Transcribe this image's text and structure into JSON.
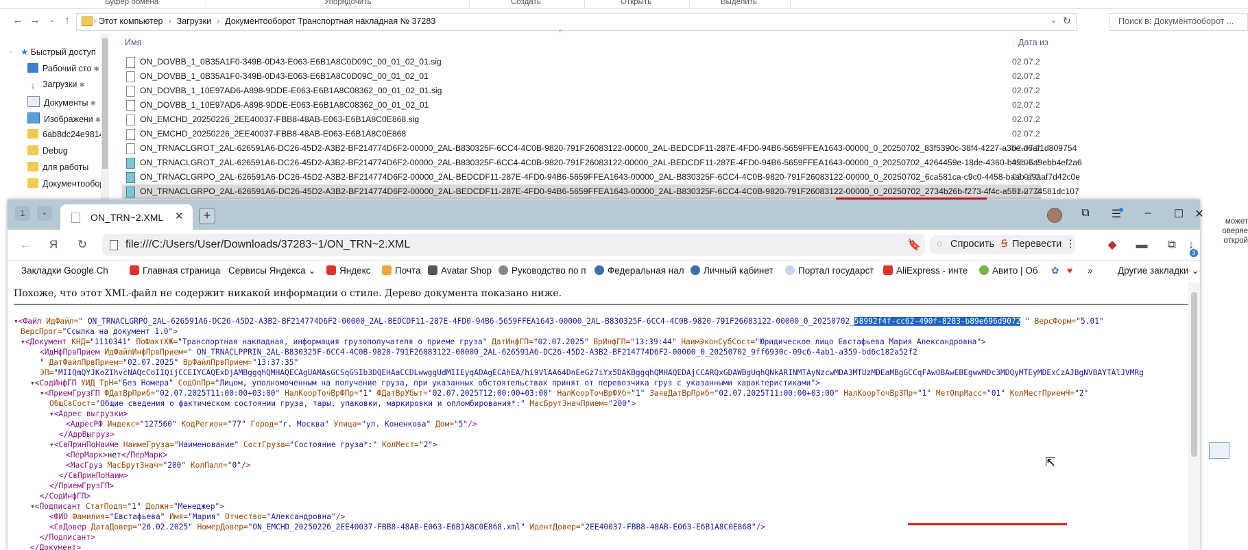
{
  "explorer": {
    "ribbon": [
      "Буфер обмена",
      "Упорядочить",
      "Создать",
      "Открыть",
      "Выделить"
    ],
    "breadcrumbs": [
      "Этот компьютер",
      "Загрузки",
      "Документооборот Транспортная накладная № 37283"
    ],
    "search_placeholder": "Поиск в: Документооборот ...",
    "nav_items": [
      "Быстрый доступ",
      "Рабочий сто",
      "Загрузки",
      "Документы",
      "Изображени",
      "6ab8dc24e9814a",
      "Debug",
      "для работы",
      "Документообор"
    ],
    "columns": {
      "name": "Имя",
      "date": "Дата из"
    },
    "files": [
      {
        "name": "ON_DOVBB_1_0B35A1F0-349B-0D43-E063-E6B1A8C0D09C_00_01_02_01.sig",
        "date": "02.07.20"
      },
      {
        "name": "ON_DOVBB_1_0B35A1F0-349B-0D43-E063-E6B1A8C0D09C_00_01_02_01",
        "date": "02.07.20"
      },
      {
        "name": "ON_DOVBB_1_10E97AD6-A898-9DDE-E063-E6B1A8C08362_00_01_02_01.sig",
        "date": "02.07.20"
      },
      {
        "name": "ON_DOVBB_1_10E97AD6-A898-9DDE-E063-E6B1A8C08362_00_01_02_01",
        "date": "02.07.20"
      },
      {
        "name": "ON_EMCHD_20250226_2EE40037-FBB8-48AB-E063-E6B1A8C0E868.sig",
        "date": "02.07.20"
      },
      {
        "name": "ON_EMCHD_20250226_2EE40037-FBB8-48AB-E063-E6B1A8C0E868",
        "date": "02.07.20"
      },
      {
        "name": "ON_TRNACLGROT_2AL-626591A6-DC26-45D2-A3B2-BF214774D6F2-00000_2AL-B830325F-6CC4-4C0B-9820-791F26083122-00000_2AL-BEDCDF11-287E-4FD0-94B6-5659FFEA1643-00000_0_20250702_83f5390c-38f4-4227-a3be-d6af1d809754",
        "date": "02.07.20"
      },
      {
        "name": "ON_TRNACLGROT_2AL-626591A6-DC26-45D2-A3B2-BF214774D6F2-00000_2AL-B830325F-6CC4-4C0B-9820-791F26083122-00000_2AL-BEDCDF11-287E-4FD0-94B6-5659FFEA1643-00000_0_20250702_4264459e-18de-4360-b45b-6a9ebb4ef2a6",
        "date": "02.07.20"
      },
      {
        "name": "ON_TRNACLGRPO_2AL-626591A6-DC26-45D2-A3B2-BF214774D6F2-00000_2AL-BEDCDF11-287E-4FD0-94B6-5659FFEA1643-00000_2AL-B830325F-6CC4-4C0B-9820-791F26083122-00000_0_20250702_6ca581ca-c9c0-4458-baab-a9aaf7d42c0e",
        "date": "02.07.20"
      },
      {
        "name": "ON_TRNACLGRPO_2AL-626591A6-DC26-45D2-A3B2-BF214774D6F2-00000_2AL-BEDCDF11-287E-4FD0-94B6-5659FFEA1643-00000_2AL-B830325F-6CC4-4C0B-9820-791F26083122-00000_0_20250702_2734b26b-f273-4f4c-a551-2774581dc107",
        "date": "02.07.20"
      }
    ],
    "right_edge_text": [
      "может",
      "оверяе",
      "открой"
    ]
  },
  "browser": {
    "tab_group_count": "1",
    "tab_title": "ON_TRN~2.XML",
    "url": "file:///C:/Users/User/Downloads/37283~1/ON_TRN~2.XML",
    "ask_label": "Спросить",
    "translate_label": "Перевести",
    "download_badge": "3",
    "bookmarks": [
      "Закладки Google Ch",
      "Главная страница",
      "Сервисы Яндекса",
      "Яндекс",
      "Почта",
      "Avatar Shop",
      "Руководство по п",
      "Федеральная нал",
      "Личный кабинет",
      "Портал государст",
      "AliExpress - инте",
      "Авито | Об"
    ],
    "other_bookmarks": "Другие закладки",
    "notice": "Похоже, что этот XML-файл не содержит никакой информации о стиле. Дерево документа показано ниже."
  },
  "xml": {
    "l1_tag": "<Файл",
    "l1_a1": "ИдФайл=",
    "l1_v1": "\" ON_TRNACLGRPO_2AL-626591A6-DC26-45D2-A3B2-BF214774D6F2-00000_2AL-BEDCDF11-287E-4FD0-94B6-5659FFEA1643-00000_2AL-B830325F-6CC4-4C0B-9820-791F26083122-00000_0_20250702_",
    "l1_hl": "58992f4f-cc62-490f-8283-b89e696d9072",
    "l1_v1end": " \"",
    "l1_a2": "ВерсФорм=",
    "l1_v2": "\"5.01\"",
    "l2_a": "ВерсПрог=",
    "l2_v": "\"Ссылка на документ 1.0\"",
    "l2_end": ">",
    "l3_tag": "<Документ",
    "l3_a1": "КНД=",
    "l3_v1": "\"1110341\"",
    "l3_a2": "ПоФактХЖ=",
    "l3_v2": "\"Транспортная накладная, информация грузополучателя о приеме груза\"",
    "l3_a3": "ДатИнфГП=",
    "l3_v3": "\"02.07.2025\"",
    "l3_a4": "ВрИнфГП=",
    "l3_v4": "\"13:39:44\"",
    "l3_a5": "НаимЭконСубСост=",
    "l3_v5": "\"Юридическое лицо Евстафьева Мария Александровна\"",
    "l3_end": ">",
    "l4_tag": "<ИдНфПрвПрием",
    "l4_a1": "ИдФайлИнфПрвПрием=",
    "l4_v1": "\" ON_TRNACLPPRIN_2AL-B830325F-6CC4-4C0B-9820-791F26083122-00000_2AL-626591A6-DC26-45D2-A3B2-BF214774D6F2-00000_0_20250702_9ff6930c-09c6-4ab1-a359-bd6c182a52f2",
    "l5_v1": "\"",
    "l5_a1": "ДатФайлПрвПрием=",
    "l5_v2": "\"02.07.2025\"",
    "l5_a2": "ВрФайлПрвПрием=",
    "l5_v3": "\"13:37:35\"",
    "l6_a": "ЭП=",
    "l6_v": "\"MIIQmQYJKoZIhvcNAQcCoIIQijCCEIYCAQExDjAMBggqhQMHAQECAgUAMAsGCSqGSIb3DQEHAaCCDLwwggUdMIIEyqADAgECAhEA/hi9VlAA64DnEeGz7iYx5DAKBggqhQMHAQEDAjCCARQxGDAWBgUqhQNkARINMTAyNzcwMDA3MTUzMDEaMBgGCCqFAwOBAwEBEgwwMDc3MDQyMTEyMDExCzAJBgNVBAYTAlJVMRg",
    "l7_tag": "<СодИнфГП",
    "l7_a1": "УИД_ТрН=",
    "l7_v1": "\"Без Номера\"",
    "l7_a2": "СодОпПр=",
    "l7_v2": "\"Лицом, уполномоченным на получение груза, при указанных обстоятельствах принят от перевозчика груз с указанными характеристиками\"",
    "l7_end": ">",
    "l8_tag": "<ПриемГрузГП",
    "l8_a1": "ФДатВрПриб=",
    "l8_v1": "\"02.07.2025T11:00:00+03:00\"",
    "l8_a2": "НалКоорТочВрФПр=",
    "l8_v2": "\"1\"",
    "l8_a3": "ФДатВрУбыт=",
    "l8_v3": "\"02.07.2025T12:00:00+03:00\"",
    "l8_a4": "НалКоорТочВрФУб=",
    "l8_v4": "\"1\"",
    "l8_a5": "ЗаявДатВрПриб=",
    "l8_v5": "\"02.07.2025T11:00:00+03:00\"",
    "l8_a6": "НалКоорТочВрЗПр=",
    "l8_v6": "\"1\"",
    "l8_a7": "МетОпрМасс=",
    "l8_v7": "\"01\"",
    "l8_a8": "КолМестПриемЧ=",
    "l8_v8": "\"2\"",
    "l9_a1": "ОбщСвСост=",
    "l9_v1": "\"Общие сведения о фактическом состоянии груза, тары, упаковки, маркировки и опломбирования*:\"",
    "l9_a2": "МасБрутЗначПрием=",
    "l9_v2": "\"200\"",
    "l9_end": ">",
    "l10_tag": "<Адрес выгрузки>",
    "l11_tag": "<АдресРФ",
    "l11_a1": "Индекс=",
    "l11_v1": "\"127560\"",
    "l11_a2": "КодРегион=",
    "l11_v2": "\"77\"",
    "l11_a3": "Город=",
    "l11_v3": "\"г. Москва\"",
    "l11_a4": "Улица=",
    "l11_v4": "\"ул. Коненкова\"",
    "l11_a5": "Дом=",
    "l11_v5": "\"5\"",
    "l11_end": "/>",
    "l12_tag": "</АдрВыгруз>",
    "l13_tag": "<СвПринПоНаиме",
    "l13_a1": "НаимеГруза=",
    "l13_v1": "\"Наименование\"",
    "l13_a2": "СостГруза=",
    "l13_v2": "\"Состояние груза*:\"",
    "l13_a3": "КолМест=",
    "l13_v3": "\"2\"",
    "l13_end": ">",
    "l14_open": "<ПерМарк>",
    "l14_text": "нет",
    "l14_close": "</ПерМарк>",
    "l15_tag": "<МасГруз",
    "l15_a1": "МасБрутЗнач=",
    "l15_v1": "\"200\"",
    "l15_a2": "КолПалл=",
    "l15_v2": "\"0\"",
    "l15_end": "/>",
    "l16_tag": "</СвПринПоНаим>",
    "l17_tag": "</ПриемГрузГП>",
    "l18_tag": "</СодИнфГП>",
    "l19_tag": "<Подписант",
    "l19_a1": "СтатПодп=",
    "l19_v1": "\"1\"",
    "l19_a2": "Должн=",
    "l19_v2": "\"Менеджер\"",
    "l19_end": ">",
    "l20_tag": "<ФИО",
    "l20_a1": "Фамилия=",
    "l20_v1": "\"Евстафьева\"",
    "l20_a2": "Имя=",
    "l20_v2": "\"Мария\"",
    "l20_a3": "Отчество=",
    "l20_v3": "\"Александровна\"",
    "l20_end": "/>",
    "l21_tag": "<СвДовер",
    "l21_a1": "ДатаДовер=",
    "l21_v1": "\"26.02.2025\"",
    "l21_a2": "НомерДовер=",
    "l21_v2": "\"ON_EMCHD_20250226_2EE40037-FBB8-48AB-E063-E6B1A8C0E868.xml\"",
    "l21_a3": "ИдентДовер=",
    "l21_v3": "\"2EE40037-FBB8-48AB-E063-E6B1A8C0E868\"",
    "l21_end": "/>",
    "l22_tag": "</Подписант>",
    "l23_tag": "</Документ>"
  },
  "colors": {
    "tag": "#881280",
    "attr": "#994500",
    "value": "#1a1aa6",
    "highlight": "#1f62c9",
    "underline": "#e0161b",
    "tabbar": "#b8c9d6"
  }
}
